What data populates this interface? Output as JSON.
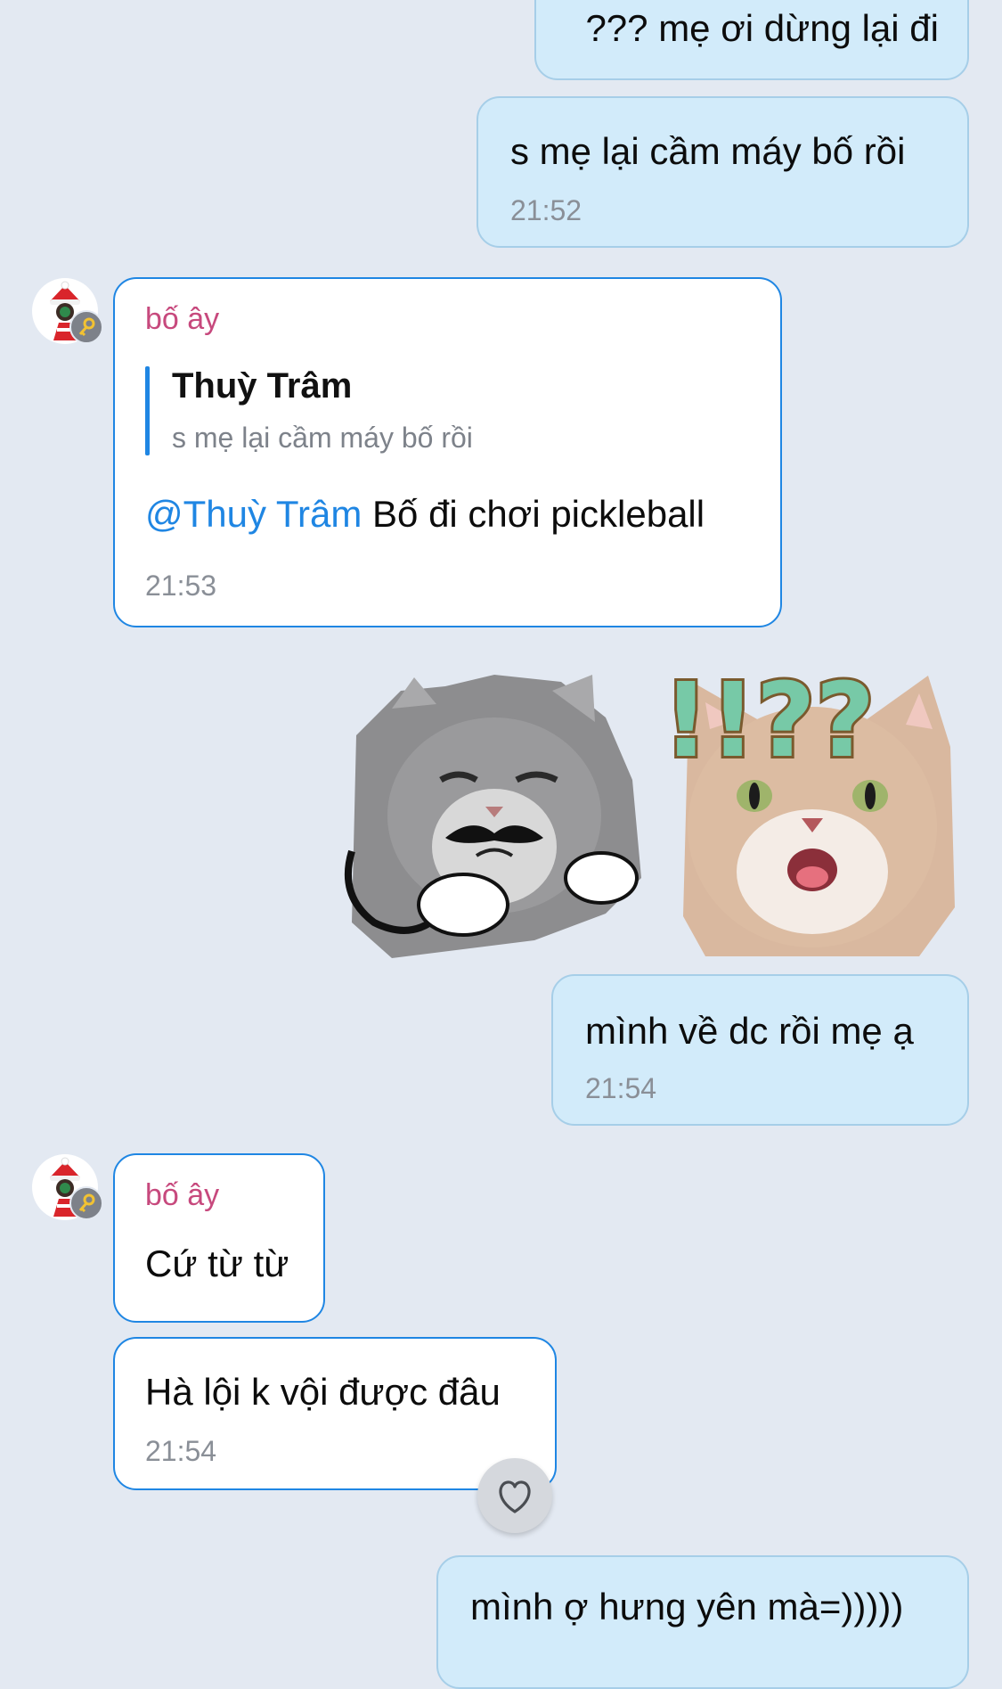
{
  "messages": {
    "m1": {
      "text": "??? mẹ ơi dừng lại đi"
    },
    "m2": {
      "text": "s mẹ lại cầm máy bố rồi",
      "time": "21:52"
    },
    "m3": {
      "sender": "bố ây",
      "quote_name": "Thuỳ Trâm",
      "quote_text": "s mẹ lại cầm máy bố rồi",
      "mention": "@Thuỳ Trâm",
      "text": " Bố đi chơi pickleball",
      "time": "21:53"
    },
    "stickers": {
      "left": "mustache-cat-shrug-sticker",
      "right": "surprised-cat-sticker",
      "right_text": "!!??"
    },
    "m4": {
      "text": "mình về dc rồi mẹ ạ",
      "time": "21:54"
    },
    "m5": {
      "sender": "bố ây",
      "text": "Cứ từ từ"
    },
    "m6": {
      "text": "Hà lội k vội được đâu",
      "time": "21:54"
    },
    "m7": {
      "text": "mình ợ hưng yên mà=)))))"
    }
  },
  "icons": {
    "reaction": "heart-outline-icon",
    "avatar_badge": "key-icon"
  },
  "colors": {
    "background": "#e3e9f2",
    "outgoing_bubble": "#d2ebfa",
    "incoming_border": "#1f86e3",
    "sender_name": "#c7497d",
    "mention": "#1f86e3"
  }
}
